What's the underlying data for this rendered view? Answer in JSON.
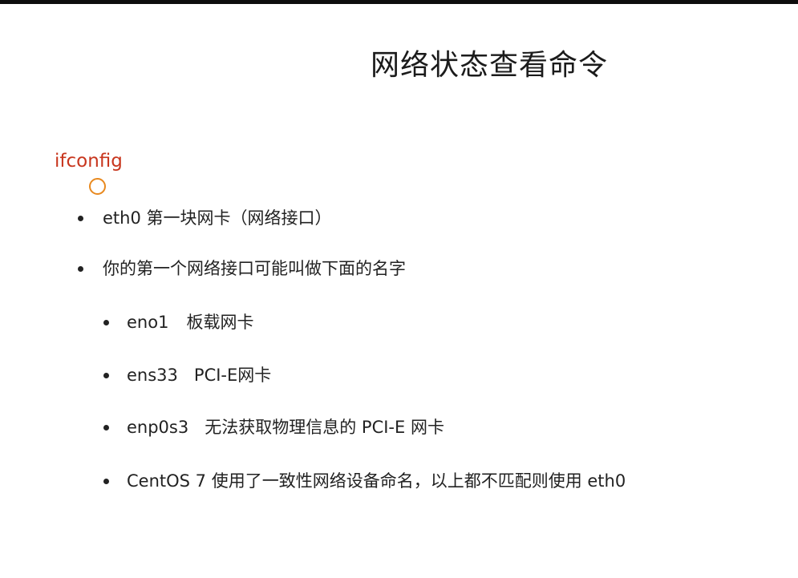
{
  "slide": {
    "title": "网络状态查看命令",
    "command": "ifconfig",
    "bullets": [
      {
        "text": "eth0 第一块网卡（网络接口）"
      },
      {
        "text": "你的第一个网络接口可能叫做下面的名字"
      }
    ],
    "sub_bullets": [
      {
        "name": "eno1",
        "desc": "板载网卡"
      },
      {
        "name": "ens33",
        "desc": "PCI-E网卡"
      },
      {
        "name": "enp0s3",
        "desc": "无法获取物理信息的 PCI-E 网卡"
      },
      {
        "text": "CentOS 7 使用了一致性网络设备命名，以上都不匹配则使用 eth0"
      }
    ]
  }
}
